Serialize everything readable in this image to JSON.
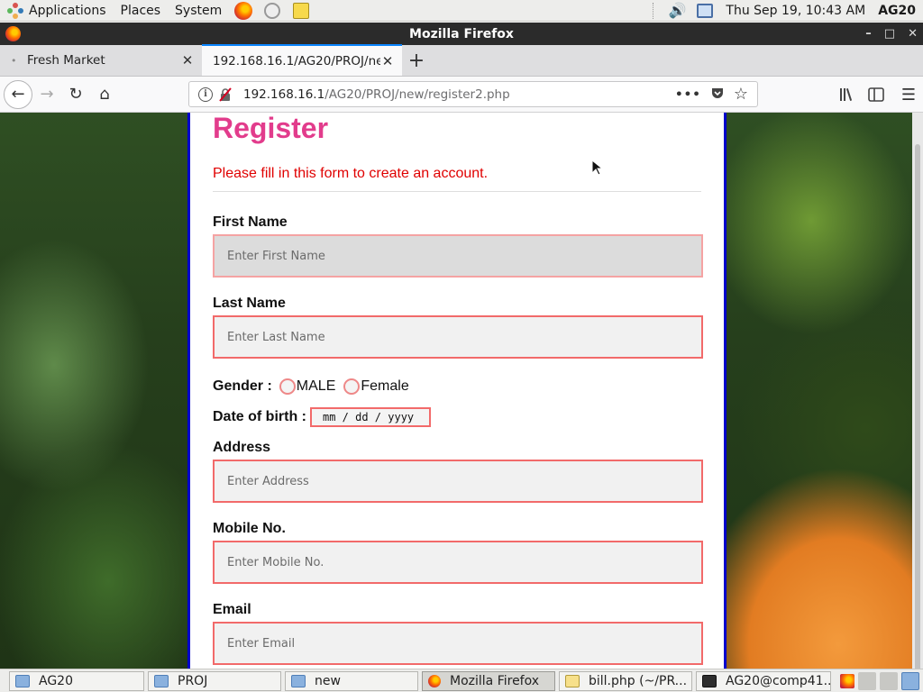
{
  "top_panel": {
    "applications": "Applications",
    "places": "Places",
    "system": "System",
    "clock": "Thu Sep 19, 10:43 AM",
    "user": "AG20"
  },
  "window": {
    "title": "Mozilla Firefox"
  },
  "tabs": [
    {
      "label": "Fresh Market",
      "active": false
    },
    {
      "label": "192.168.16.1/AG20/PROJ/new",
      "active": true
    }
  ],
  "url": {
    "host": "192.168.16.1",
    "path": "/AG20/PROJ/new/register2.php"
  },
  "form": {
    "title": "Register",
    "subtitle": "Please fill in this form to create an account.",
    "first_name": {
      "label": "First Name",
      "placeholder": "Enter First Name"
    },
    "last_name": {
      "label": "Last Name",
      "placeholder": "Enter Last Name"
    },
    "gender": {
      "label": "Gender :",
      "option_male": "MALE",
      "option_female": "Female"
    },
    "dob": {
      "label": "Date of birth :",
      "placeholder": "mm / dd / yyyy"
    },
    "address": {
      "label": "Address",
      "placeholder": "Enter Address"
    },
    "mobile": {
      "label": "Mobile No.",
      "placeholder": "Enter Mobile No."
    },
    "email": {
      "label": "Email",
      "placeholder": "Enter Email"
    }
  },
  "taskbar": [
    {
      "label": "AG20",
      "icon": "folder-icon"
    },
    {
      "label": "PROJ",
      "icon": "folder-icon"
    },
    {
      "label": "new",
      "icon": "folder-icon"
    },
    {
      "label": "Mozilla Firefox",
      "icon": "firefox-icon",
      "active": true
    },
    {
      "label": "bill.php (~/PR...",
      "icon": "text-editor-icon"
    },
    {
      "label": "AG20@comp41...",
      "icon": "terminal-icon"
    }
  ],
  "colors": {
    "title_pink": "#e23c8c",
    "subtitle_red": "#e00000",
    "panel_border_blue": "#0000cc",
    "input_border": "#f26a6a"
  }
}
